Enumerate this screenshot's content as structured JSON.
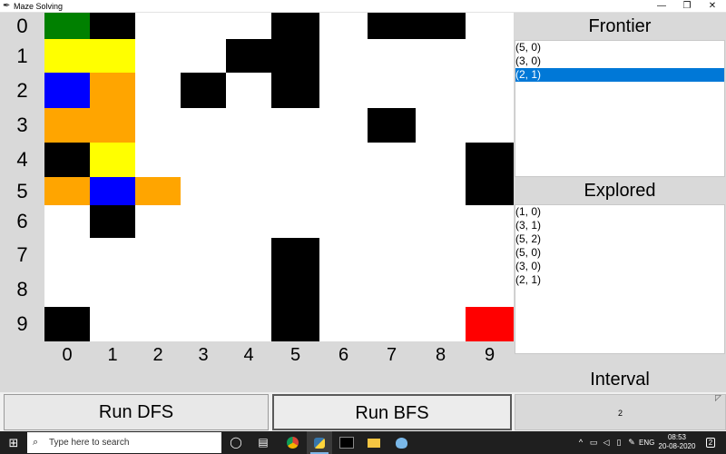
{
  "window": {
    "title": "Maze Solving",
    "app_icon": "feather-icon",
    "minimize_glyph": "—",
    "maximize_glyph": "❐",
    "close_glyph": "✕"
  },
  "maze": {
    "rows": [
      "0",
      "1",
      "2",
      "3",
      "4",
      "5",
      "6",
      "7",
      "8",
      "9"
    ],
    "cols": [
      "0",
      "1",
      "2",
      "3",
      "4",
      "5",
      "6",
      "7",
      "8",
      "9"
    ],
    "colors": {
      "empty": "#ffffff",
      "wall": "#000000",
      "start": "#008000",
      "goal": "#ff0000",
      "frontier": "#ffff00",
      "explored": "#ffa500",
      "current": "#0000ff"
    },
    "grid": [
      [
        "start",
        "wall",
        "empty",
        "empty",
        "empty",
        "wall",
        "empty",
        "wall",
        "wall",
        "empty"
      ],
      [
        "frontier",
        "frontier",
        "empty",
        "empty",
        "wall",
        "wall",
        "empty",
        "empty",
        "empty",
        "empty"
      ],
      [
        "current",
        "explored",
        "empty",
        "wall",
        "empty",
        "wall",
        "empty",
        "empty",
        "empty",
        "empty"
      ],
      [
        "explored",
        "explored",
        "empty",
        "empty",
        "empty",
        "empty",
        "empty",
        "wall",
        "empty",
        "empty"
      ],
      [
        "wall",
        "frontier",
        "empty",
        "empty",
        "empty",
        "empty",
        "empty",
        "empty",
        "empty",
        "wall"
      ],
      [
        "explored",
        "current",
        "explored",
        "empty",
        "empty",
        "empty",
        "empty",
        "empty",
        "empty",
        "wall"
      ],
      [
        "empty",
        "wall",
        "empty",
        "empty",
        "empty",
        "empty",
        "empty",
        "empty",
        "empty",
        "empty"
      ],
      [
        "empty",
        "empty",
        "empty",
        "empty",
        "empty",
        "wall",
        "empty",
        "empty",
        "empty",
        "empty"
      ],
      [
        "empty",
        "empty",
        "empty",
        "empty",
        "empty",
        "wall",
        "empty",
        "empty",
        "empty",
        "empty"
      ],
      [
        "wall",
        "empty",
        "empty",
        "empty",
        "empty",
        "wall",
        "empty",
        "empty",
        "empty",
        "goal"
      ]
    ]
  },
  "frontier": {
    "title": "Frontier",
    "items": [
      "(5, 0)",
      "(3, 0)",
      "(2, 1)"
    ],
    "selected_index": 2
  },
  "explored": {
    "title": "Explored",
    "items": [
      "(1, 0)",
      "(3, 1)",
      "(5, 2)",
      "(5, 0)",
      "(3, 0)",
      "(2, 1)"
    ]
  },
  "controls": {
    "interval_label": "Interval",
    "interval_value": "2",
    "run_dfs_label": "Run DFS",
    "run_bfs_label": "Run BFS"
  },
  "taskbar": {
    "search_placeholder": "Type here to search",
    "language": "ENG",
    "time": "08:53",
    "date": "20-08-2020",
    "notification_count": "2"
  }
}
